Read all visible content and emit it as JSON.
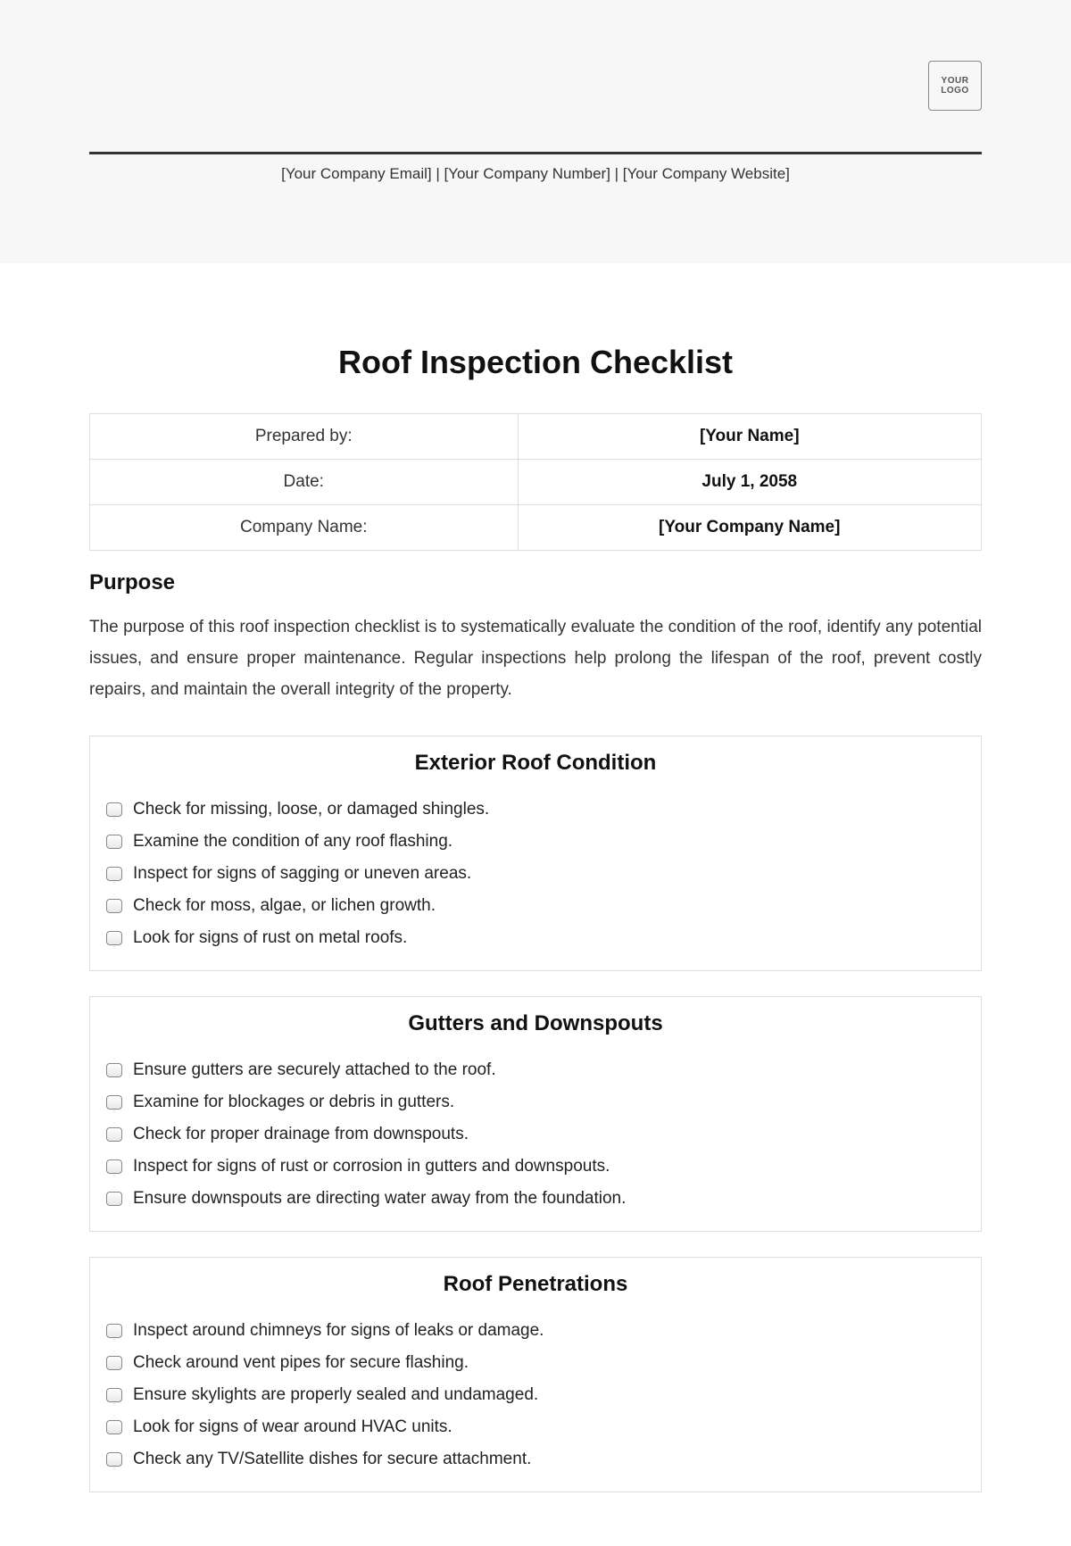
{
  "logo_text": "YOUR LOGO",
  "contact_line": "[Your Company Email] | [Your Company Number] | [Your Company Website]",
  "title": "Roof Inspection Checklist",
  "meta_rows": [
    {
      "label": "Prepared by:",
      "value": "[Your Name]"
    },
    {
      "label": "Date:",
      "value": "July 1, 2058"
    },
    {
      "label": "Company Name:",
      "value": "[Your Company Name]"
    }
  ],
  "purpose_heading": "Purpose",
  "purpose_text": "The purpose of this roof inspection checklist is to systematically evaluate the condition of the roof, identify any potential issues, and ensure proper maintenance. Regular inspections help prolong the lifespan of the roof, prevent costly repairs, and maintain the overall integrity of the property.",
  "sections": [
    {
      "title": "Exterior Roof Condition",
      "items": [
        "Check for missing, loose, or damaged shingles.",
        "Examine the condition of any roof flashing.",
        "Inspect for signs of sagging or uneven areas.",
        "Check for moss, algae, or lichen growth.",
        "Look for signs of rust on metal roofs."
      ]
    },
    {
      "title": "Gutters and Downspouts",
      "items": [
        "Ensure gutters are securely attached to the roof.",
        "Examine for blockages or debris in gutters.",
        "Check for proper drainage from downspouts.",
        "Inspect for signs of rust or corrosion in gutters and downspouts.",
        "Ensure downspouts are directing water away from the foundation."
      ]
    },
    {
      "title": "Roof Penetrations",
      "items": [
        "Inspect around chimneys for signs of leaks or damage.",
        "Check around vent pipes for secure flashing.",
        "Ensure skylights are properly sealed and undamaged.",
        "Look for signs of wear around HVAC units.",
        "Check any TV/Satellite dishes for secure attachment."
      ]
    }
  ]
}
